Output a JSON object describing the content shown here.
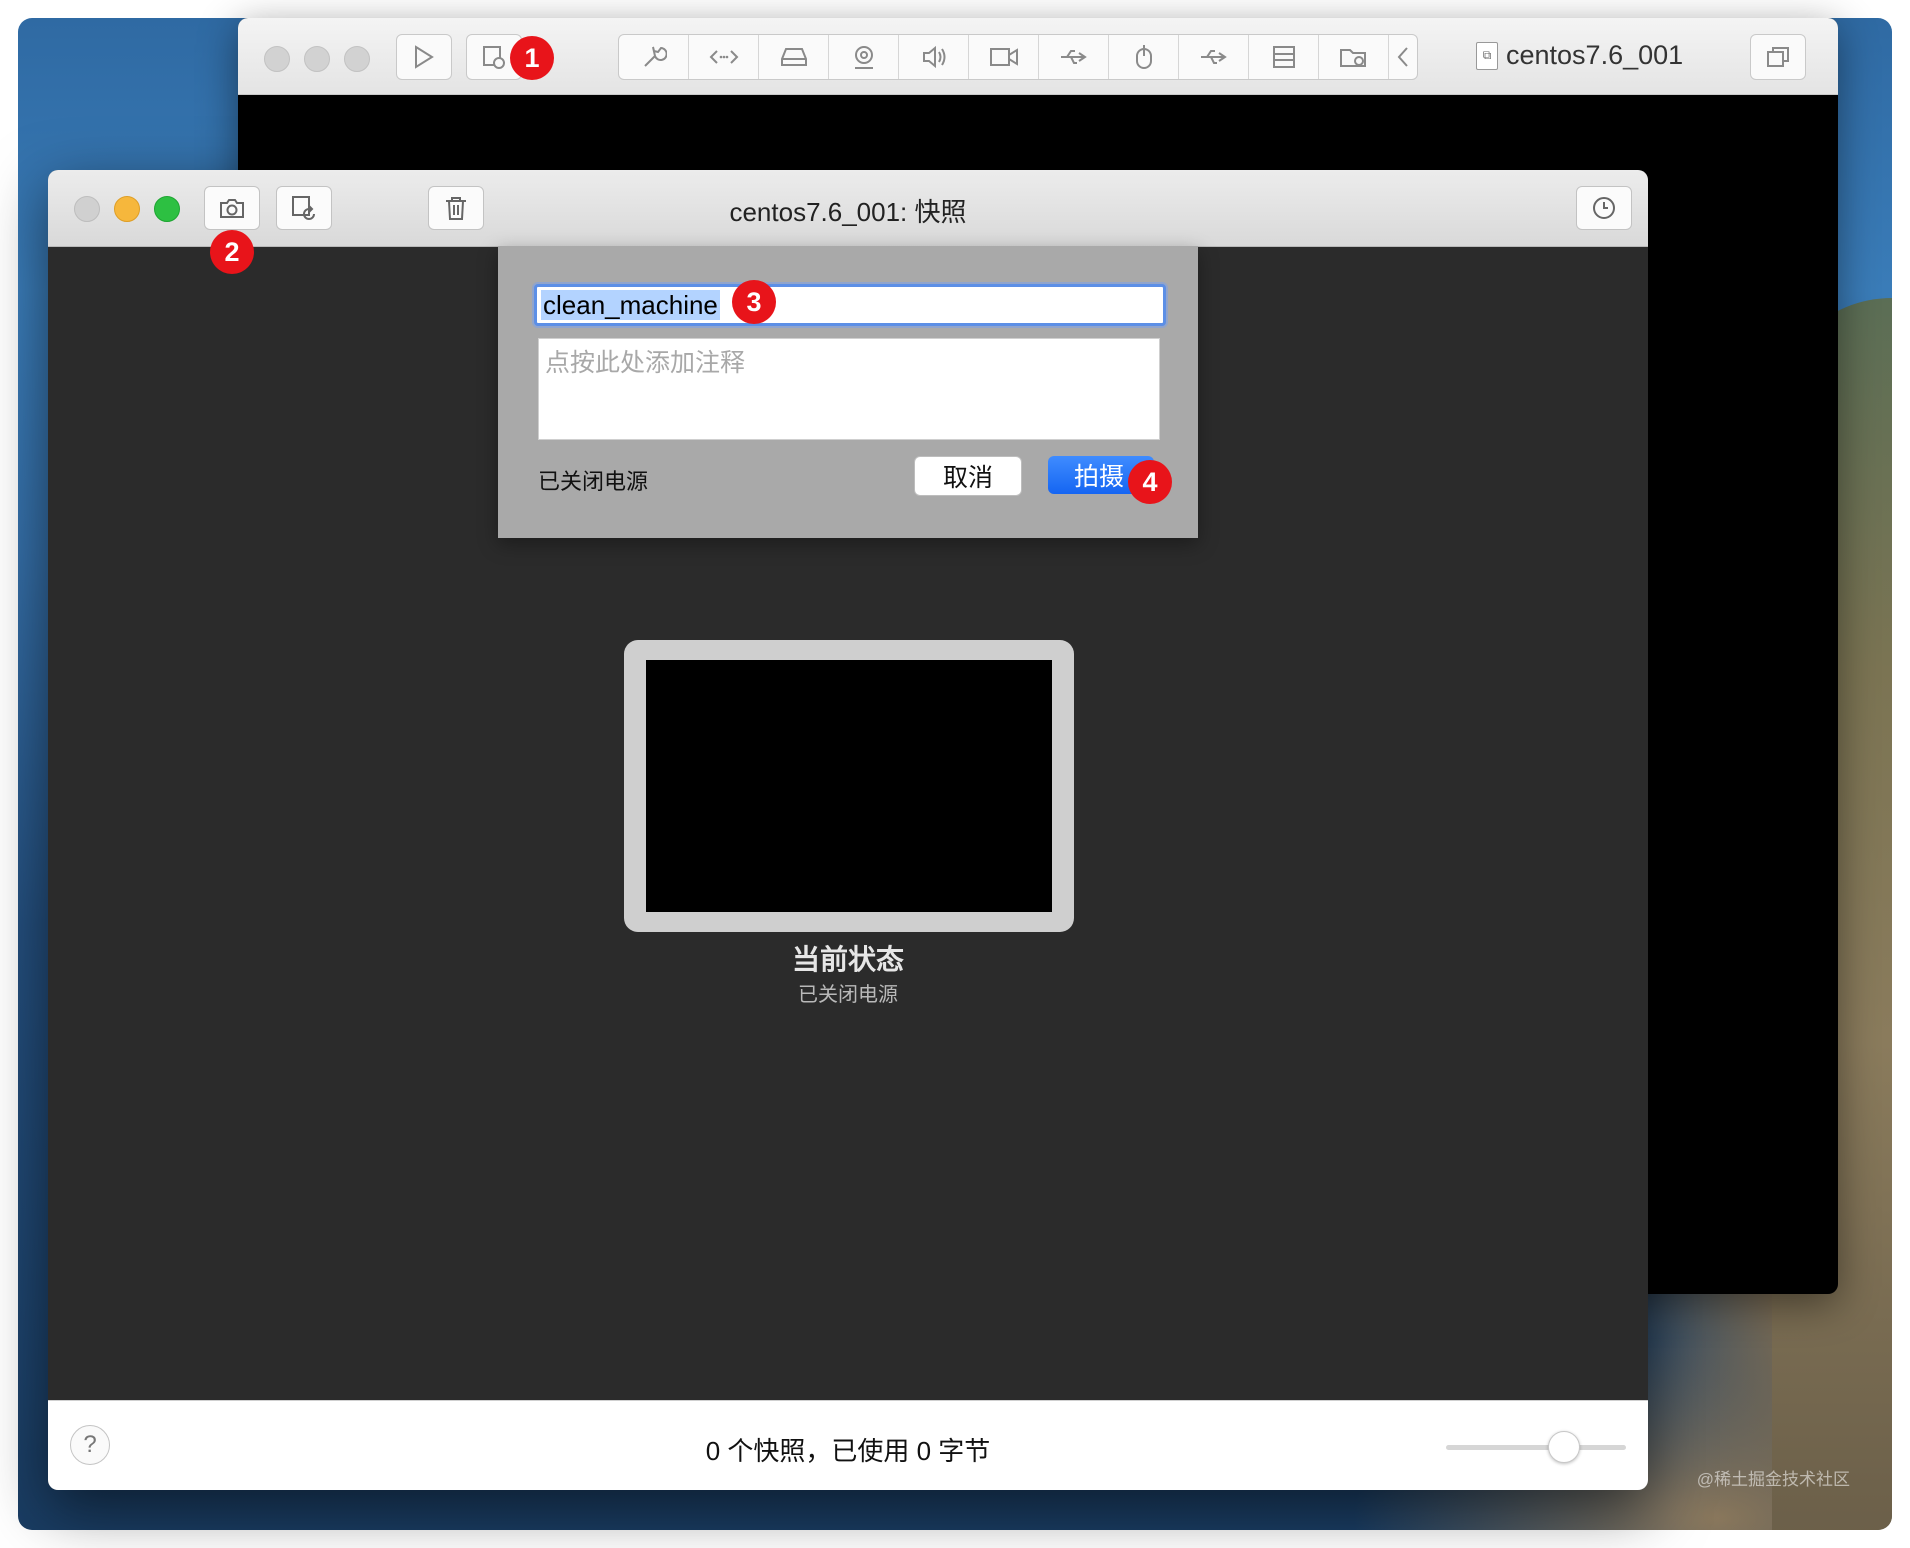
{
  "vm_window": {
    "title": "centos7.6_001",
    "toolbar_icons": [
      "play-icon",
      "snapshot-manager-icon",
      "wrench-icon",
      "code-icon",
      "hard-disk-icon",
      "webcam-icon",
      "speaker-icon",
      "camera-video-icon",
      "usb-icon",
      "mouse-icon",
      "usb-icon",
      "drive-icon",
      "shared-folder-icon",
      "chevron-left-icon",
      "window-icon"
    ]
  },
  "snapshot_window": {
    "title": "centos7.6_001: 快照",
    "toolbar_icons": [
      "camera-icon",
      "restore-icon",
      "trash-icon",
      "clock-icon"
    ]
  },
  "dialog": {
    "name_value": "clean_machine",
    "note_placeholder": "点按此处添加注释",
    "power_state": "已关闭电源",
    "cancel_label": "取消",
    "take_label": "拍摄"
  },
  "current_state": {
    "title": "当前状态",
    "subtitle": "已关闭电源"
  },
  "status_bar": {
    "help_label": "?",
    "summary": "0 个快照，已使用 0 字节",
    "zoom_level": 0.65
  },
  "markers": [
    "1",
    "2",
    "3",
    "4"
  ],
  "watermark": "@稀土掘金技术社区",
  "colors": {
    "accent": "#1a6cf5",
    "marker": "#e8141a",
    "dark_bg": "#2b2b2b"
  }
}
